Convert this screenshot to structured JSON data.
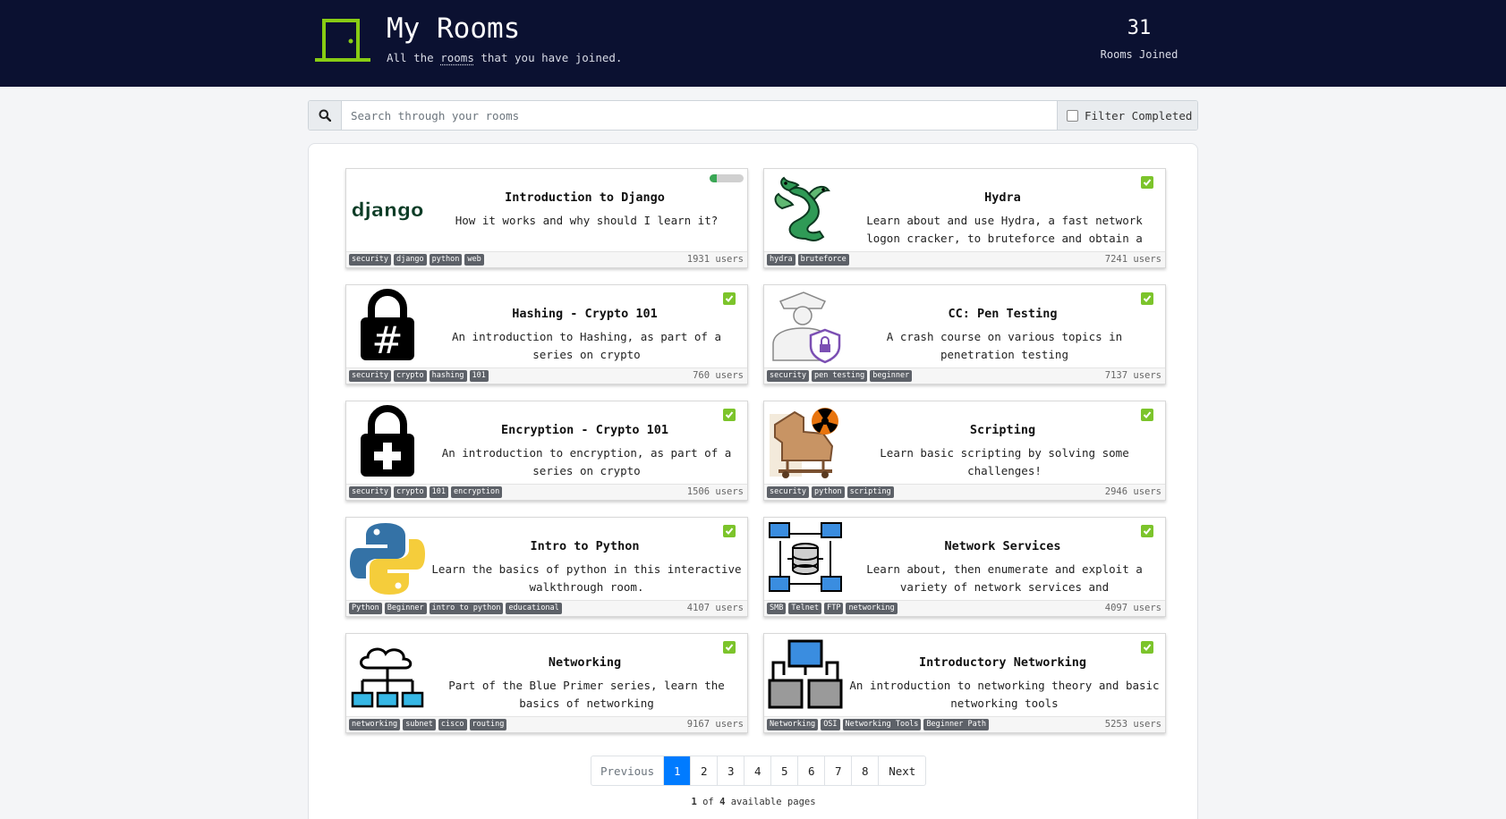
{
  "header": {
    "title": "My Rooms",
    "subtitle_pre": "All the ",
    "subtitle_link": "rooms",
    "subtitle_post": " that you have joined.",
    "joined_count": "31",
    "joined_label": "Rooms Joined"
  },
  "search": {
    "placeholder": "Search through your rooms",
    "filter_label": "Filter Completed"
  },
  "rooms": [
    {
      "title": "Introduction to Django",
      "desc": "How it works and why should I learn it?",
      "tags": [
        "security",
        "django",
        "python",
        "web"
      ],
      "users": "1931 users",
      "progress": 0.2,
      "completed": false,
      "icon": "django-logo-icon",
      "logo_text": "django"
    },
    {
      "title": "Hydra",
      "desc": "Learn about and use Hydra, a fast network logon cracker, to bruteforce and obtain a website's…",
      "tags": [
        "hydra",
        "bruteforce"
      ],
      "users": "7241 users",
      "completed": true,
      "icon": "hydra-dragon-icon"
    },
    {
      "title": "Hashing - Crypto 101",
      "desc": "An introduction to Hashing, as part of a series on crypto",
      "tags": [
        "security",
        "crypto",
        "hashing",
        "101"
      ],
      "users": "760 users",
      "completed": true,
      "icon": "hash-lock-icon"
    },
    {
      "title": "CC: Pen Testing",
      "desc": "A crash course on various topics in penetration testing",
      "tags": [
        "security",
        "pen testing",
        "beginner"
      ],
      "users": "7137 users",
      "completed": true,
      "icon": "security-guard-icon"
    },
    {
      "title": "Encryption - Crypto 101",
      "desc": "An introduction to encryption, as part of a series on crypto",
      "tags": [
        "security",
        "crypto",
        "101",
        "encryption"
      ],
      "users": "1506 users",
      "completed": true,
      "icon": "plus-lock-icon"
    },
    {
      "title": "Scripting",
      "desc": "Learn basic scripting by solving some challenges!",
      "tags": [
        "security",
        "python",
        "scripting"
      ],
      "users": "2946 users",
      "completed": true,
      "icon": "trojan-horse-icon"
    },
    {
      "title": "Intro to Python",
      "desc": "Learn the basics of python in this interactive walkthrough room.",
      "tags": [
        "Python",
        "Beginner",
        "intro to python",
        "educational"
      ],
      "users": "4107 users",
      "completed": true,
      "icon": "python-logo-icon"
    },
    {
      "title": "Network Services",
      "desc": "Learn about, then enumerate and exploit a variety of network services and misconfigurations.",
      "tags": [
        "SMB",
        "Telnet",
        "FTP",
        "networking"
      ],
      "users": "4097 users",
      "completed": true,
      "icon": "network-database-icon"
    },
    {
      "title": "Networking",
      "desc": "Part of the Blue Primer series, learn the basics of networking",
      "tags": [
        "networking",
        "subnet",
        "cisco",
        "routing"
      ],
      "users": "9167 users",
      "completed": true,
      "icon": "cloud-network-icon"
    },
    {
      "title": "Introductory Networking",
      "desc": "An introduction to networking theory and basic networking tools",
      "tags": [
        "Networking",
        "OSI",
        "Networking Tools",
        "Beginner Path"
      ],
      "users": "5253 users",
      "completed": true,
      "icon": "computer-network-icon"
    }
  ],
  "pagination": {
    "prev": "Previous",
    "pages": [
      "1",
      "2",
      "3",
      "4",
      "5",
      "6",
      "7",
      "8"
    ],
    "next": "Next",
    "info_current": "1",
    "info_of": " of ",
    "info_total": "4",
    "info_suffix": " available pages"
  },
  "colors": {
    "header_bg": "#0b1131",
    "door": "#88cc14",
    "check": "#7cc42b",
    "active_page": "#007bff",
    "progress": "#3aa755"
  }
}
